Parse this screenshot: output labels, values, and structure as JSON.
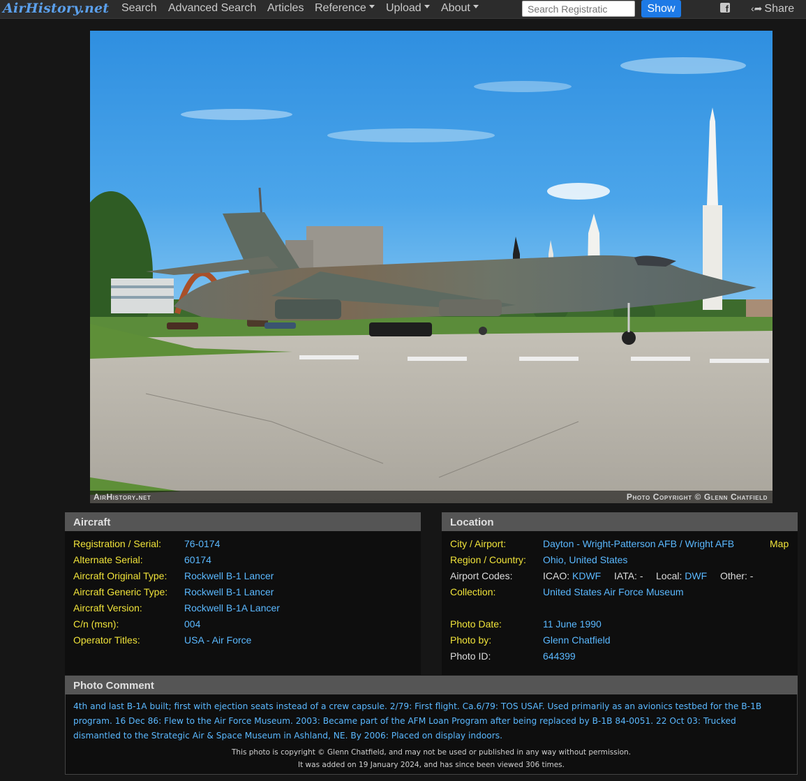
{
  "nav": {
    "brand": "AirHistory.net",
    "items": [
      {
        "label": "Search"
      },
      {
        "label": "Advanced Search"
      },
      {
        "label": "Articles"
      },
      {
        "label": "Reference"
      },
      {
        "label": "Upload"
      },
      {
        "label": "About"
      }
    ],
    "search_placeholder": "Search Registratic",
    "show_label": "Show",
    "share_label": "Share",
    "facebook_icon": "facebook-icon",
    "share_icon": "share-icon"
  },
  "photo": {
    "watermark_left": "AirHistory.net",
    "copyright_label": "Photo Copyright © Glenn Chatfield"
  },
  "aircraft": {
    "heading": "Aircraft",
    "fields": [
      {
        "label": "Registration / Serial:",
        "value": "76-0174"
      },
      {
        "label": "Alternate Serial:",
        "value": "60174"
      },
      {
        "label": "Aircraft Original Type:",
        "value": "Rockwell B-1 Lancer"
      },
      {
        "label": "Aircraft Generic Type:",
        "value": "Rockwell B-1 Lancer"
      },
      {
        "label": "Aircraft Version:",
        "value": "Rockwell B-1A Lancer"
      },
      {
        "label": "C/n (msn):",
        "value": "004"
      },
      {
        "label": "Operator Titles:",
        "value": "USA - Air Force"
      }
    ]
  },
  "location": {
    "heading": "Location",
    "city_label": "City / Airport:",
    "city_value": "Dayton - Wright-Patterson AFB / Wright AFB",
    "map_label": "Map",
    "region_label": "Region / Country:",
    "region_value": "Ohio, United States",
    "codes_label": "Airport Codes:",
    "icao_label": "ICAO:",
    "icao_value": "KDWF",
    "iata_label": "IATA:",
    "iata_value": "-",
    "local_label": "Local:",
    "local_value": "DWF",
    "other_label": "Other:",
    "other_value": "-",
    "collection_label": "Collection:",
    "collection_value": "United States Air Force Museum",
    "date_label": "Photo Date:",
    "date_value": "11 June 1990",
    "by_label": "Photo by:",
    "by_value": "Glenn Chatfield",
    "id_label": "Photo ID:",
    "id_value": "644399"
  },
  "comment": {
    "heading": "Photo Comment",
    "text": "4th and last B-1A built; first with ejection seats instead of a crew capsule. 2/79: First flight. Ca.6/79: TOS USAF. Used primarily as an avionics testbed for the B-1B program. 16 Dec 86: Flew to the Air Force Museum. 2003: Became part of the AFM Loan Program after being replaced by B-1B 84-0051. 22 Oct 03: Trucked dismantled to the Strategic Air & Space Museum in Ashland, NE. By 2006: Placed on display indoors.",
    "copyright_note": "This photo is copyright © Glenn Chatfield, and may not be used or published in any way without permission.",
    "added_note": "It was added on 19 January 2024, and has since been viewed 306 times."
  },
  "colors": {
    "label": "#f0e33a",
    "value": "#5ab8ff",
    "brand": "#5ba0ec",
    "button": "#1d7ae6",
    "panel_header": "#555555"
  }
}
